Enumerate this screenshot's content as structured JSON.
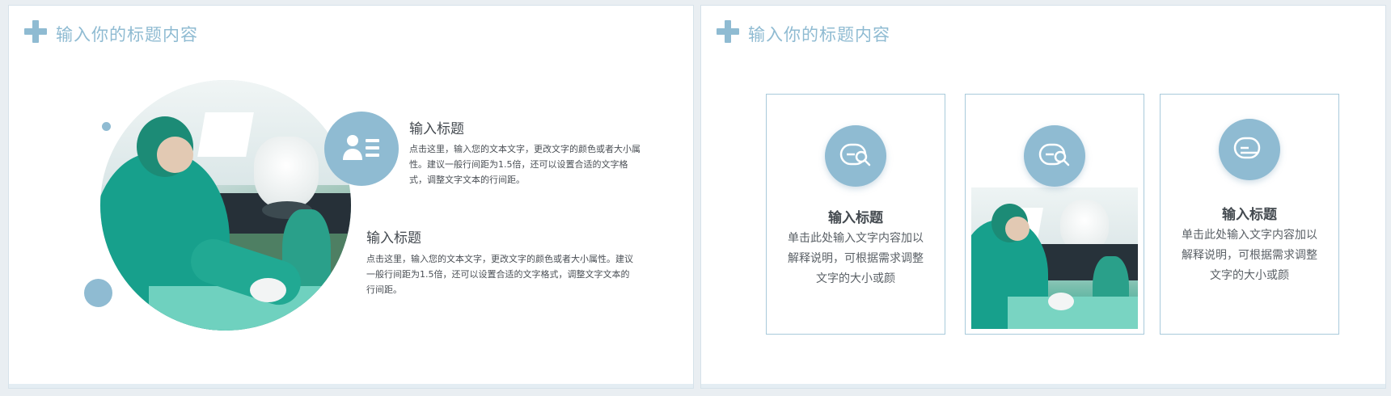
{
  "colors": {
    "accent": "#8fbbd2",
    "heading": "#444a50",
    "text": "#4a4f55"
  },
  "slide1": {
    "title": "输入你的标题内容",
    "photo": "surgery-photo",
    "icon": "user-list-icon",
    "block1": {
      "heading": "输入标题",
      "text": "点击这里，输入您的文本文字，更改文字的颜色或者大小属性。建议一般行间距为1.5倍，还可以设置合适的文字格式，调整文字文本的行间距。"
    },
    "block2": {
      "heading": "输入标题",
      "text": "点击这里，输入您的文本文字，更改文字的颜色或者大小属性。建议一般行间距为1.5倍，还可以设置合适的文字格式，调整文字文本的行间距。"
    }
  },
  "slide2": {
    "title": "输入你的标题内容",
    "cards": [
      {
        "icon": "search-list-icon",
        "heading": "输入标题",
        "text": "单击此处输入文字内容加以解释说明，可根据需求调整文字的大小或颜"
      },
      {
        "icon": "search-list-icon",
        "photo": "surgery-photo"
      },
      {
        "icon": "search-list-icon",
        "heading": "输入标题",
        "text": "单击此处输入文字内容加以解释说明，可根据需求调整文字的大小或颜"
      }
    ]
  }
}
